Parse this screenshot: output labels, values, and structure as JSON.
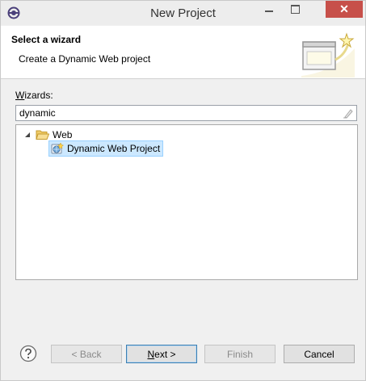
{
  "window": {
    "title": "New Project",
    "close_glyph": "✕"
  },
  "header": {
    "title": "Select a wizard",
    "description": "Create a Dynamic Web project",
    "banner_icon": "wizard-banner-icon"
  },
  "wizards": {
    "label_mnemonic": "W",
    "label_rest": "izards:",
    "filter_value": "dynamic"
  },
  "tree": {
    "items": [
      {
        "label": "Web",
        "icon": "folder-open-icon",
        "expanded": true
      },
      {
        "label": "Dynamic Web Project",
        "icon": "dynamic-web-project-icon",
        "selected": true
      }
    ]
  },
  "buttons": {
    "back": "< Back",
    "next": "Next >",
    "next_mnemonic": "N",
    "next_rest": "ext >",
    "finish": "Finish",
    "cancel": "Cancel"
  },
  "colors": {
    "selection_bg": "#cce8ff",
    "selection_border": "#99d1ff",
    "close_button": "#c7504a"
  }
}
